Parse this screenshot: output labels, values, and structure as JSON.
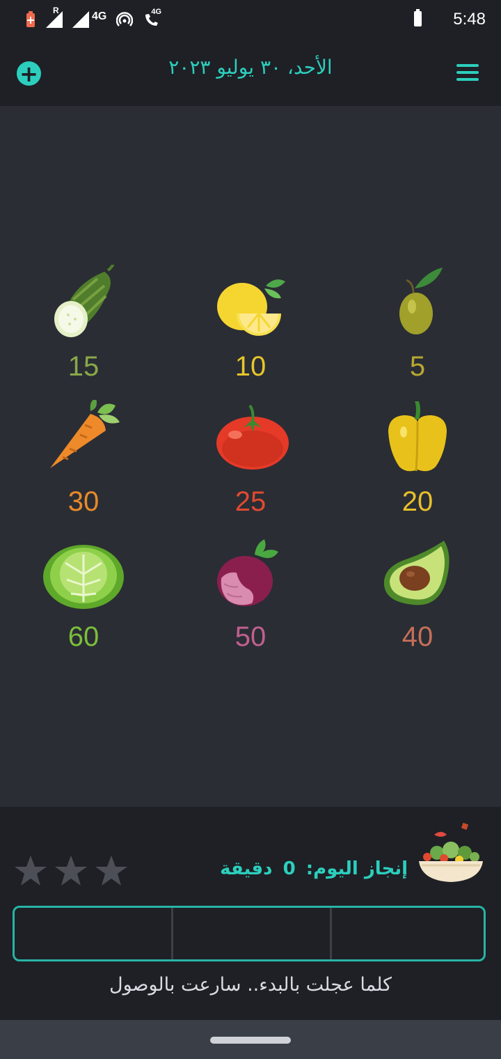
{
  "status_bar": {
    "time": "5:48",
    "icons": [
      "battery-saver-icon",
      "signal-roaming-icon",
      "signal-icon",
      "network-4g-icon",
      "hotspot-icon",
      "volte-call-icon",
      "battery-icon"
    ],
    "network_label": "4G",
    "roaming_label": "R",
    "call_label": "4G"
  },
  "app_bar": {
    "add_icon": "plus-circle-icon",
    "title": "الأحد، ٣٠ يوليو ٢٠٢٣",
    "menu_icon": "hamburger-menu-icon",
    "accent_color": "#2ccfbd"
  },
  "vegetables": [
    {
      "name": "cucumber",
      "value": "15",
      "color": "#8aa84a"
    },
    {
      "name": "lemon",
      "value": "10",
      "color": "#e6c62a"
    },
    {
      "name": "olive",
      "value": "5",
      "color": "#b8a830"
    },
    {
      "name": "carrot",
      "value": "30",
      "color": "#e98a2a"
    },
    {
      "name": "tomato",
      "value": "25",
      "color": "#e04a30"
    },
    {
      "name": "bell-pepper",
      "value": "20",
      "color": "#e8c02a"
    },
    {
      "name": "cabbage",
      "value": "60",
      "color": "#7bbf3a"
    },
    {
      "name": "beetroot",
      "value": "50",
      "color": "#c0608f"
    },
    {
      "name": "avocado",
      "value": "40",
      "color": "#c66f58"
    }
  ],
  "achievement": {
    "label": "إنجاز اليوم:",
    "minutes": "0",
    "unit": "دقيقة",
    "stars_total": 3,
    "stars_earned": 0,
    "bowl_icon": "salad-bowl-icon"
  },
  "progress": {
    "segments": 3,
    "filled": 0
  },
  "motto": "كلما عجلت بالبدء.. سارعت بالوصول"
}
